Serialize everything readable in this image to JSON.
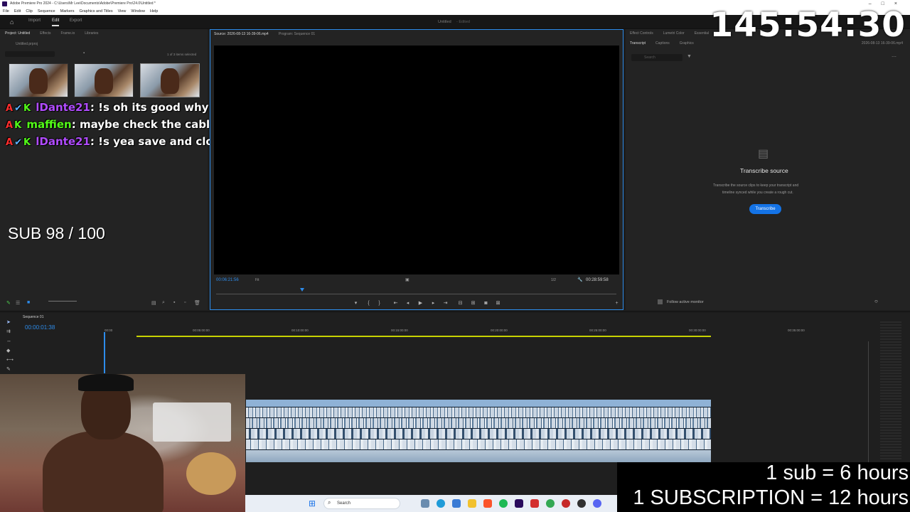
{
  "window": {
    "title": "Adobe Premiere Pro 2024 - C:\\Users\\Mr Lee\\Documents\\Adobe\\Premiere Pro\\24.0\\Untitled *",
    "controls": [
      "–",
      "□",
      "×"
    ]
  },
  "menu": [
    "File",
    "Edit",
    "Clip",
    "Sequence",
    "Markers",
    "Graphics and Titles",
    "View",
    "Window",
    "Help"
  ],
  "header": {
    "tabs": [
      "Import",
      "Edit",
      "Export"
    ],
    "active_tab": "Edit",
    "project_title": "Untitled",
    "project_status": "- Edited"
  },
  "project_panel": {
    "tabs": [
      "Project: Untitled",
      "Effects",
      "Frame.io",
      "Libraries"
    ],
    "file": "Untitled.prproj",
    "selection_info": "1 of 3 items selected"
  },
  "monitor": {
    "tabs": [
      "Source: 2026-08-13 16-39-06.mp4",
      "Program: Sequence 01"
    ],
    "timecode_current": "00:06:21:56",
    "fit": "Fit",
    "resolution": "1/2",
    "timecode_duration": "00:28:59:58"
  },
  "right_panel": {
    "tabs_top": [
      "Effect Controls",
      "Lumetri Color",
      "Essential"
    ],
    "tabs": [
      "Transcript",
      "Captions",
      "Graphics"
    ],
    "file": "2026-08-13 16-39-06.mp4",
    "search_placeholder": "Search",
    "heading": "Transcribe source",
    "description_line1": "Transcribe the source clips to keep your transcript and",
    "description_line2": "timeline synced while you create a rough cut.",
    "button": "Transcribe",
    "follow_label": "Follow active monitor"
  },
  "timeline": {
    "sequence_tab": "Sequence 01",
    "timecode": "00:00:01:38",
    "ruler": [
      "00:00",
      "00:05:00:00",
      "00:10:00:00",
      "00:15:00:00",
      "00:20:00:00",
      "00:25:00:00",
      "00:30:00:00",
      "00:35:00:00"
    ]
  },
  "stream_overlay": {
    "timer": "145:54:30",
    "chat": [
      {
        "user": "lDante21",
        "message": ": !s oh its good why is it still black",
        "color": "#b14cff"
      },
      {
        "user": "maffien",
        "message": ": maybe check the cables again just to be safe",
        "color": "#53fc18"
      },
      {
        "user": "lDante21",
        "message": ": !s yea save and close",
        "color": "#b14cff"
      }
    ],
    "sub_goal": "SUB 98 / 100",
    "rule_sub": "1 sub = 6 hours",
    "rule_subscription": "1 SUBSCRIPTION = 12 hours"
  },
  "taskbar": {
    "search_placeholder": "Search"
  }
}
